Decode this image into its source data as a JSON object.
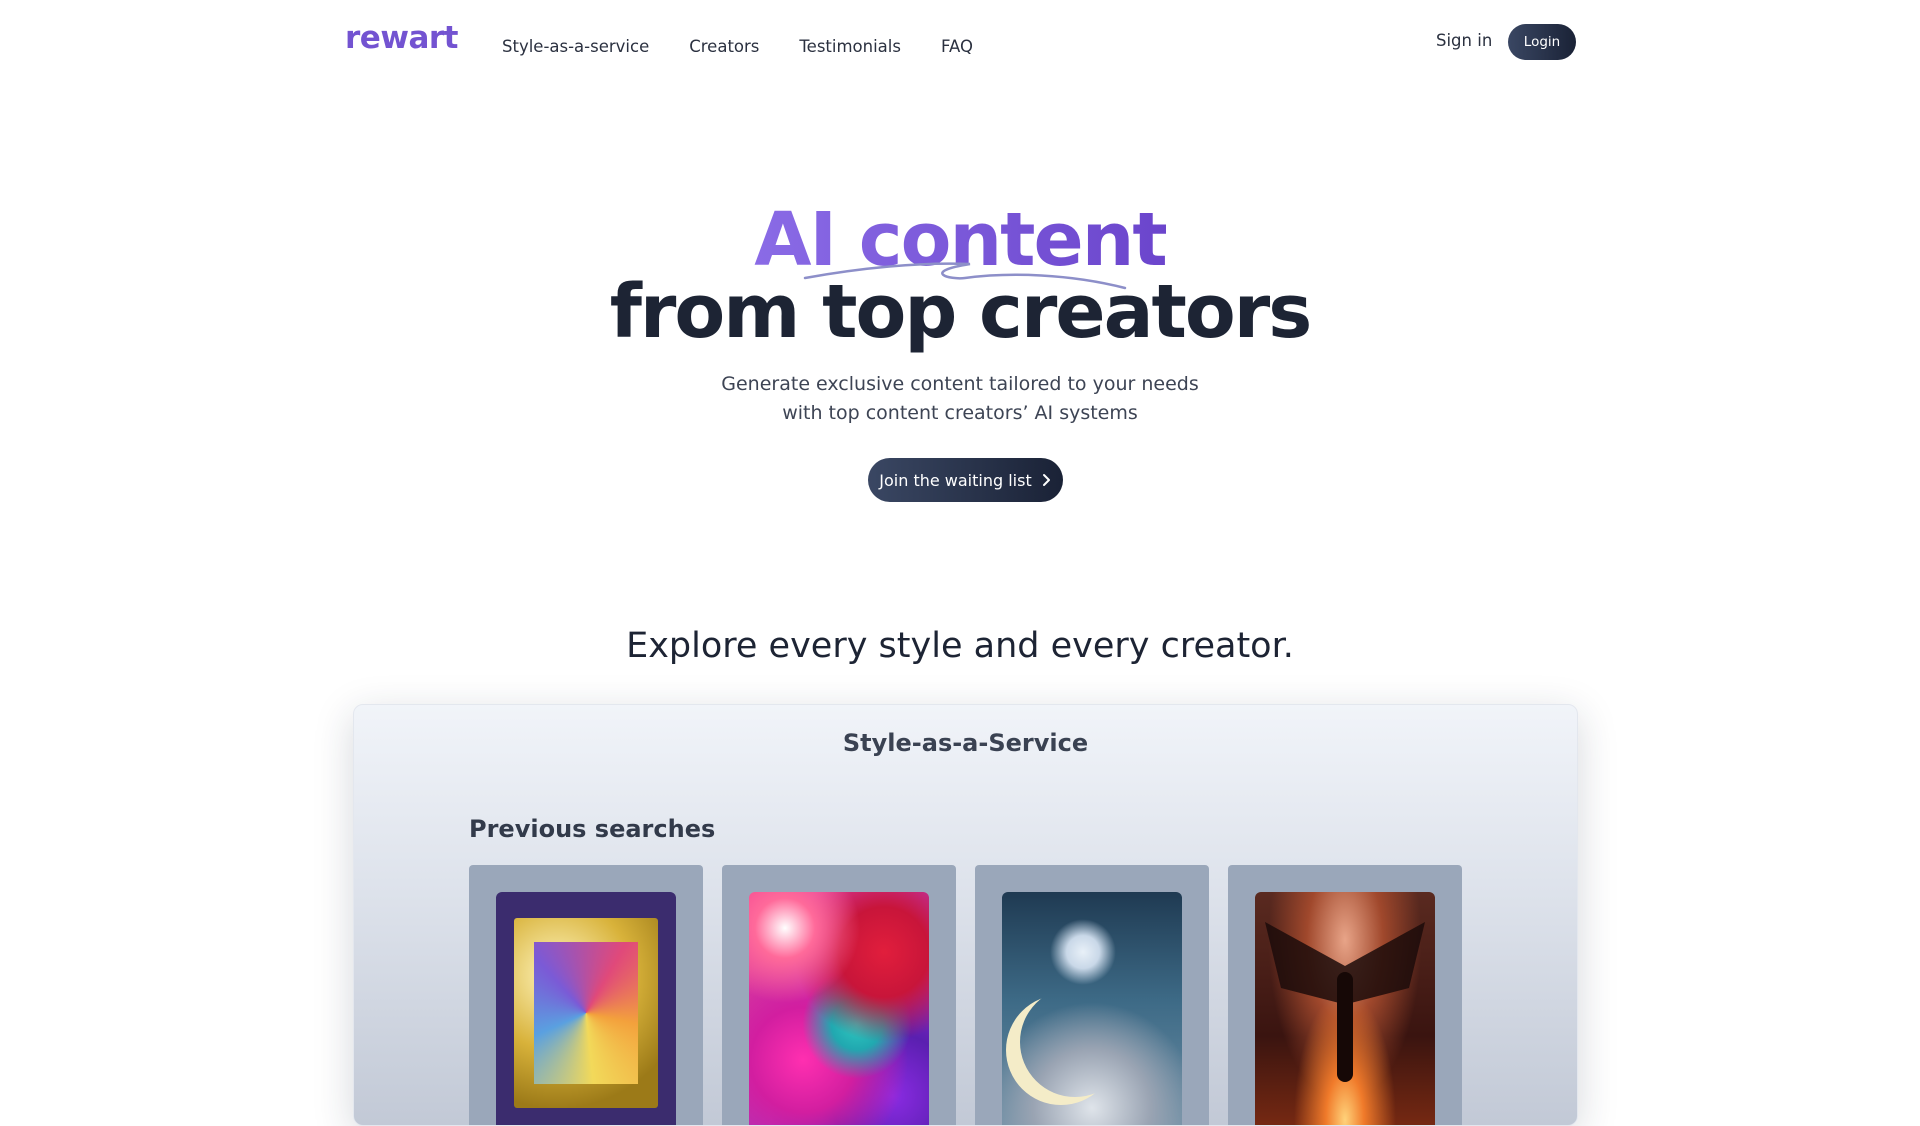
{
  "header": {
    "logo": "rewart",
    "nav": [
      "Style-as-a-service",
      "Creators",
      "Testimonials",
      "FAQ"
    ],
    "sign_in": "Sign in",
    "login": "Login"
  },
  "hero": {
    "highlight": "AI content",
    "headline": "from top creators",
    "subtitle_line1": "Generate exclusive content tailored to your needs",
    "subtitle_line2": "with top content creators’ AI systems",
    "cta": "Join the waiting list",
    "cta_icon": "chevron-right-icon"
  },
  "explore": {
    "title": "Explore every style and every creator.",
    "panel_title": "Style-as-a-Service",
    "previous_searches_title": "Previous searches"
  },
  "colors": {
    "brand_purple": "#7353d1",
    "dark_button": "#1a2236"
  }
}
